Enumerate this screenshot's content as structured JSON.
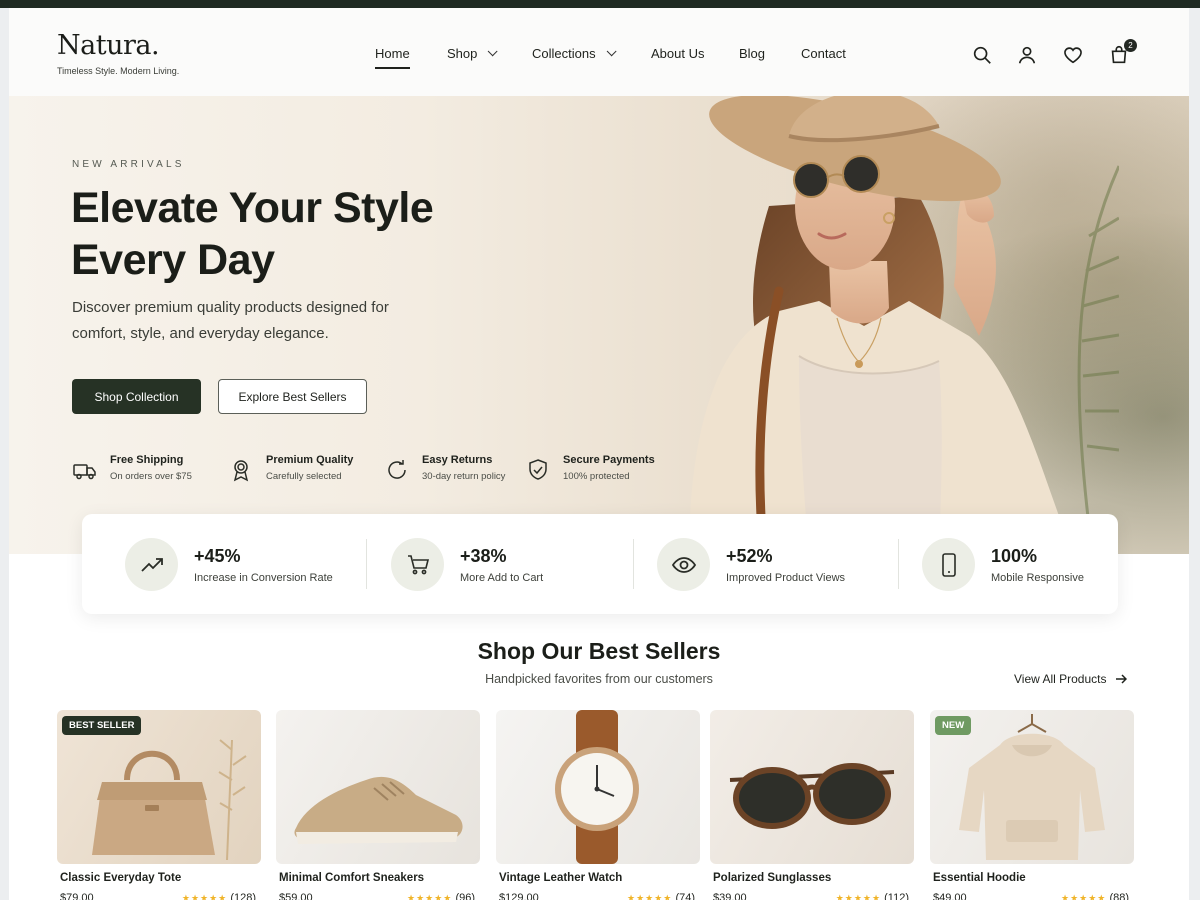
{
  "brand": {
    "logo": "Natura.",
    "tagline": "Timeless Style. Modern Living."
  },
  "nav": {
    "items": [
      {
        "label": "Home",
        "active": true,
        "dropdown": false
      },
      {
        "label": "Shop",
        "active": false,
        "dropdown": true
      },
      {
        "label": "Collections",
        "active": false,
        "dropdown": true
      },
      {
        "label": "About Us",
        "active": false,
        "dropdown": false
      },
      {
        "label": "Blog",
        "active": false,
        "dropdown": false
      },
      {
        "label": "Contact",
        "active": false,
        "dropdown": false
      }
    ],
    "icons": [
      "search-icon",
      "user-icon",
      "heart-icon",
      "cart-icon"
    ],
    "cart_count": "2"
  },
  "hero": {
    "eyebrow": "NEW ARRIVALS",
    "title_line1": "Elevate Your Style",
    "title_line2": "Every Day",
    "subtitle_line1": "Discover premium quality products designed for",
    "subtitle_line2": "comfort, style, and everyday elegance.",
    "primary_cta": "Shop Collection",
    "secondary_cta": "Explore Best Sellers",
    "features": [
      {
        "icon": "truck-icon",
        "title": "Free Shipping",
        "subtitle": "On orders over $75"
      },
      {
        "icon": "award-icon",
        "title": "Premium Quality",
        "subtitle": "Carefully selected"
      },
      {
        "icon": "refresh-icon",
        "title": "Easy Returns",
        "subtitle": "30-day return policy"
      },
      {
        "icon": "shield-check-icon",
        "title": "Secure Payments",
        "subtitle": "100% protected"
      }
    ]
  },
  "stats": [
    {
      "icon": "trending-up-icon",
      "value": "+45%",
      "label": "Increase in Conversion Rate"
    },
    {
      "icon": "cart-icon",
      "value": "+38%",
      "label": "More Add to Cart"
    },
    {
      "icon": "eye-icon",
      "value": "+52%",
      "label": "Improved Product Views"
    },
    {
      "icon": "smartphone-icon",
      "value": "100%",
      "label": "Mobile Responsive"
    }
  ],
  "best_sellers": {
    "title": "Shop Our Best Sellers",
    "subtitle": "Handpicked favorites from our customers",
    "view_all": "View All Products",
    "products": [
      {
        "name": "Classic Everyday Tote",
        "badge": "BEST SELLER",
        "price": "$79.00",
        "rating": "★★★★★",
        "reviews": "(128)"
      },
      {
        "name": "Minimal Comfort Sneakers",
        "badge": "",
        "price": "$59.00",
        "rating": "★★★★★",
        "reviews": "(96)"
      },
      {
        "name": "Vintage Leather Watch",
        "badge": "",
        "price": "$129.00",
        "rating": "★★★★★",
        "reviews": "(74)"
      },
      {
        "name": "Polarized Sunglasses",
        "badge": "",
        "price": "$39.00",
        "rating": "★★★★★",
        "reviews": "(112)"
      },
      {
        "name": "Essential Hoodie",
        "badge": "NEW",
        "price": "$49.00",
        "rating": "★★★★★",
        "reviews": "(88)"
      }
    ]
  },
  "colors": {
    "accent": "#263225",
    "new_badge": "#6f9a62",
    "star": "#f0b429"
  }
}
